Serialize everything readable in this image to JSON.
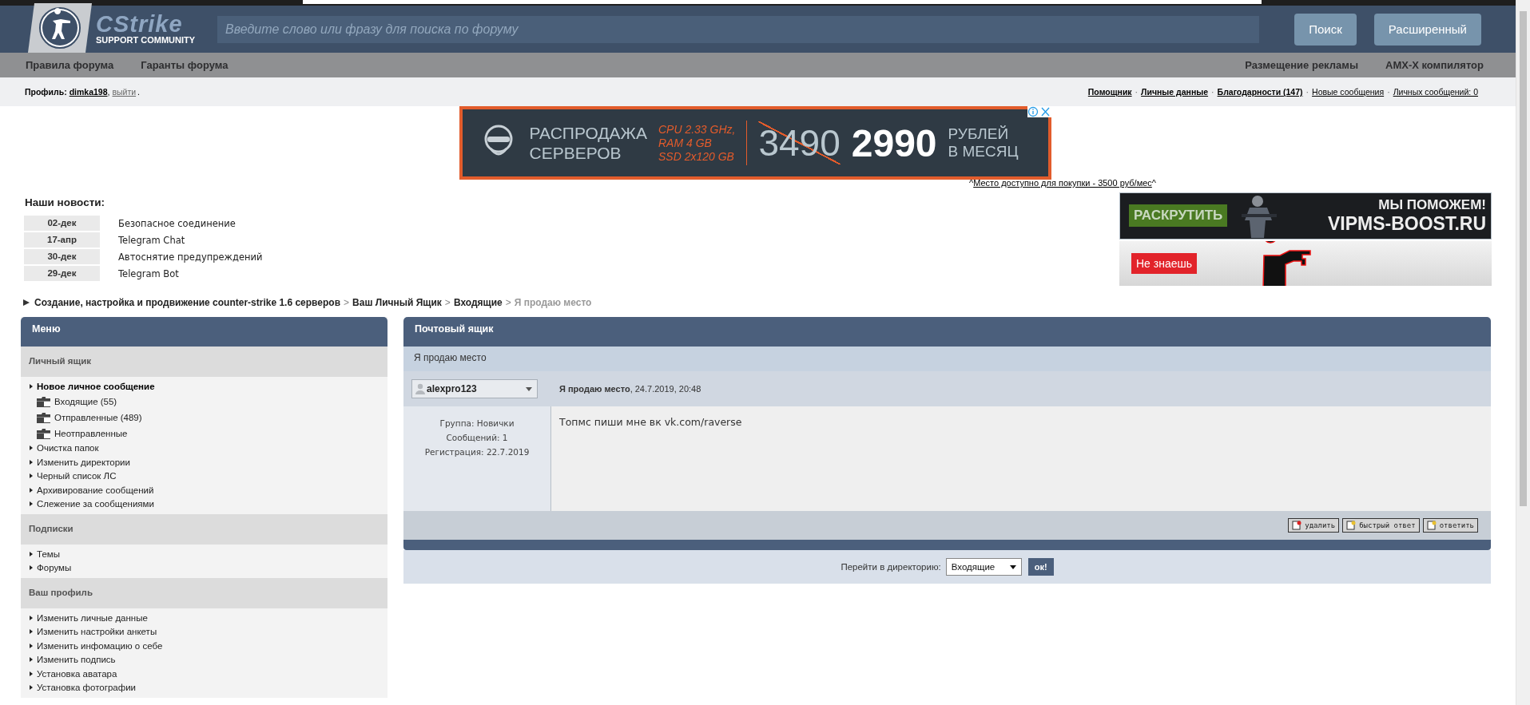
{
  "header": {
    "logo": {
      "title": "CStrike",
      "subtitle": "SUPPORT COMMUNITY"
    },
    "search": {
      "placeholder": "Введите слово или фразу для поиска по форуму"
    },
    "buttons": [
      "Поиск",
      "Расширенный"
    ]
  },
  "nav": {
    "left": [
      "Правила форума",
      "Гаранты форума"
    ],
    "right": [
      "Размещение рекламы",
      "AMX-X компилятор"
    ]
  },
  "profile_bar": {
    "label": "Профиль:",
    "user": "dimka198",
    "comma": ",",
    "logout": "выйти",
    "end": ".",
    "separator": "·",
    "links": [
      {
        "text": "Помощник",
        "bold": true
      },
      {
        "text": "Личные данные",
        "bold": true
      },
      {
        "text": "Благодарности (147)",
        "bold": true
      },
      {
        "text": "Новые сообщения",
        "bold": false
      },
      {
        "text": "Личных сообщений: 0",
        "bold": false
      }
    ]
  },
  "ad_banner": {
    "title_lines": [
      "РАСПРОДАЖА",
      "СЕРВЕРОВ"
    ],
    "specs": [
      "CPU 2.33 GHz,",
      "RAM 4 GB",
      "SSD 2x120 GB"
    ],
    "old_price": "3490",
    "new_price": "2990",
    "unit_lines": [
      "РУБЛЕЙ",
      "В МЕСЯЦ"
    ]
  },
  "ad_note": {
    "prefix": "^",
    "link": "Место доступно для покупки - 3500 руб/мес",
    "suffix": "^"
  },
  "side_ads": [
    {
      "kind": "boost",
      "button": "РАСКРУТИТЬ",
      "lines": [
        "МЫ ПОМОЖЕМ!",
        "VIPMS-BOOST.RU"
      ]
    },
    {
      "kind": "figure",
      "button": "Не знаешь"
    }
  ],
  "news": {
    "title": "Наши новости:",
    "items": [
      {
        "date": "02-дек",
        "title": "Безопасное соединение"
      },
      {
        "date": "17-апр",
        "title": "Telegram Chat"
      },
      {
        "date": "30-дек",
        "title": "Автоснятие предупреждений"
      },
      {
        "date": "29-дек",
        "title": "Telegram Bot"
      }
    ]
  },
  "breadcrumb": {
    "links": [
      "Создание, настройка и продвижение counter-strike 1.6 серверов",
      "Ваш Личный Ящик",
      "Входящие"
    ],
    "separator": ">",
    "current": "Я продаю место"
  },
  "menu": {
    "title": "Меню",
    "sections": [
      {
        "title": "Личный ящик",
        "items": [
          {
            "kind": "primary",
            "label": "Новое личное сообщение"
          },
          {
            "kind": "folder",
            "label": "Входящие (55)"
          },
          {
            "kind": "folder",
            "label": "Отправленные (489)"
          },
          {
            "kind": "folder",
            "label": "Неотправленные"
          },
          {
            "kind": "link",
            "label": "Очистка папок"
          },
          {
            "kind": "link",
            "label": "Изменить директории"
          },
          {
            "kind": "link",
            "label": "Черный список ЛС"
          },
          {
            "kind": "link",
            "label": "Архивирование сообщений"
          },
          {
            "kind": "link",
            "label": "Слежение за сообщениями"
          }
        ]
      },
      {
        "title": "Подписки",
        "items": [
          {
            "kind": "link",
            "label": "Темы"
          },
          {
            "kind": "link",
            "label": "Форумы"
          }
        ]
      },
      {
        "title": "Ваш профиль",
        "items": [
          {
            "kind": "link",
            "label": "Изменить личные данные"
          },
          {
            "kind": "link",
            "label": "Изменить настройки анкеты"
          },
          {
            "kind": "link",
            "label": "Изменить инфомацию о себе"
          },
          {
            "kind": "link",
            "label": "Изменить подпись"
          },
          {
            "kind": "link",
            "label": "Установка аватара"
          },
          {
            "kind": "link",
            "label": "Установка фотографии"
          }
        ]
      }
    ]
  },
  "mailbox": {
    "title": "Почтовый ящик",
    "subject": "Я продаю место",
    "author": "alexpro123",
    "post_header": "**Я продаю место**, 24.7.2019, 20:48",
    "author_info": [
      "Группа: Новички",
      "Сообщений: 1",
      "Регистрация: 22.7.2019"
    ],
    "body": "Топмс пиши мне вк vk.com/raverse",
    "actions": [
      "удалить",
      "быстрый ответ",
      "ответить"
    ],
    "jump": {
      "label": "Перейти в директорию:",
      "value": "Входящие",
      "button": "ок!"
    }
  }
}
